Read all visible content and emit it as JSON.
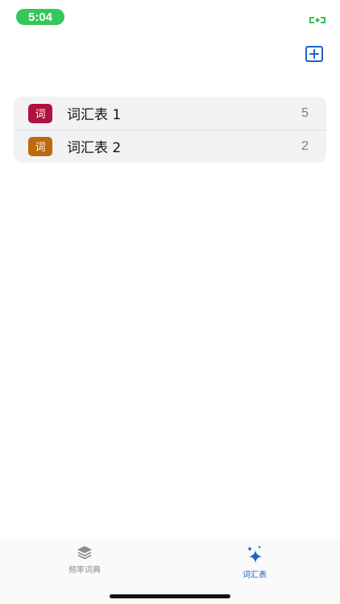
{
  "status_bar": {
    "time": "5:04",
    "time_color": "#34c759",
    "indicator_icon": "screen-mirroring-icon"
  },
  "header": {
    "add_icon": "plus-square-icon"
  },
  "vocab_lists": [
    {
      "badge": "词",
      "badge_color": "#b0123f",
      "label": "词汇表 1",
      "count": "5"
    },
    {
      "badge": "词",
      "badge_color": "#bb6a0c",
      "label": "词汇表 2",
      "count": "2"
    }
  ],
  "tab_bar": {
    "tabs": [
      {
        "label": "频率词典",
        "icon": "stack-layers-icon",
        "selected": false
      },
      {
        "label": "词汇表",
        "icon": "sparkles-icon",
        "selected": true
      }
    ],
    "active_color": "#1a63c8",
    "inactive_color": "#8e8e93"
  }
}
